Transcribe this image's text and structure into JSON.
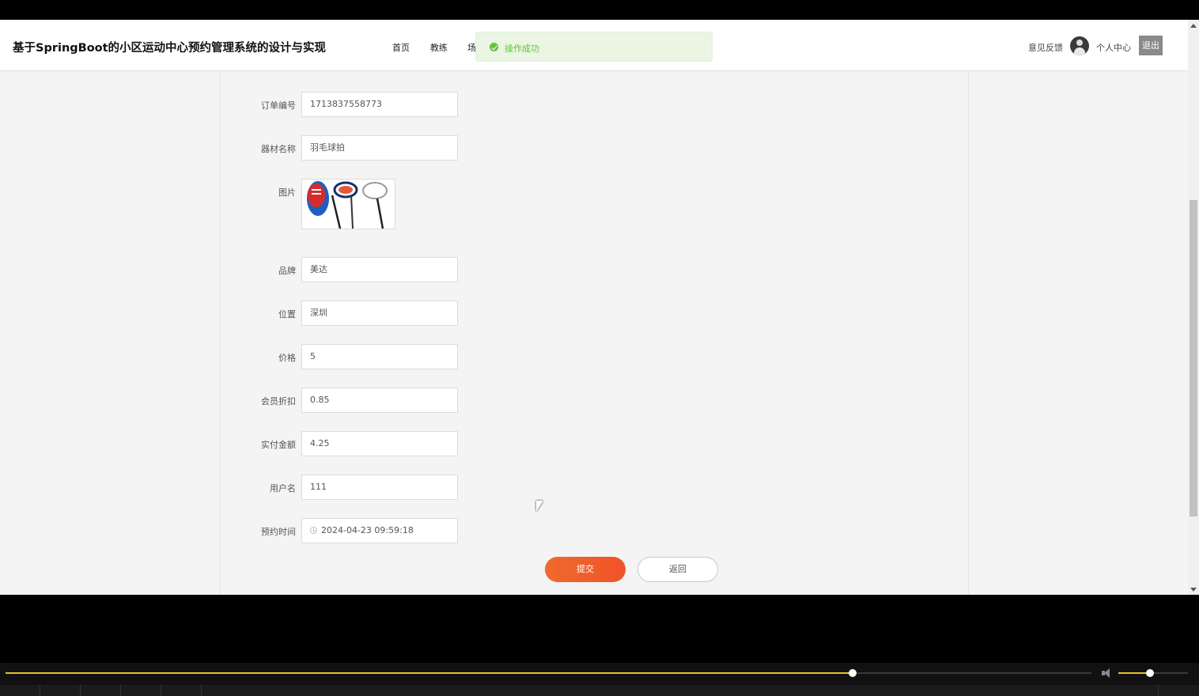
{
  "header": {
    "title": "基于SpringBoot的小区运动中心预约管理系统的设计与实现",
    "nav": [
      "首页",
      "教练",
      "场"
    ],
    "feedback": "意见反馈",
    "user_center": "个人中心",
    "logout": "退出"
  },
  "toast": {
    "message": "操作成功"
  },
  "form": {
    "fields": [
      {
        "label": "订单编号",
        "value": "1713837558773"
      },
      {
        "label": "器材名称",
        "value": "羽毛球拍"
      },
      {
        "label": "品牌",
        "value": "美达"
      },
      {
        "label": "位置",
        "value": "深圳"
      },
      {
        "label": "价格",
        "value": "5"
      },
      {
        "label": "会员折扣",
        "value": "0.85"
      },
      {
        "label": "实付金额",
        "value": "4.25"
      },
      {
        "label": "用户名",
        "value": "111"
      },
      {
        "label": "预约时间",
        "value": "2024-04-23 09:59:18"
      }
    ],
    "image_label": "图片",
    "submit": "提交",
    "back": "返回"
  },
  "player": {
    "progress": 0.78,
    "volume": 0.45
  },
  "colors": {
    "accent": "#f0602a",
    "success": "#67c23a",
    "progress": "#e6c22a"
  }
}
